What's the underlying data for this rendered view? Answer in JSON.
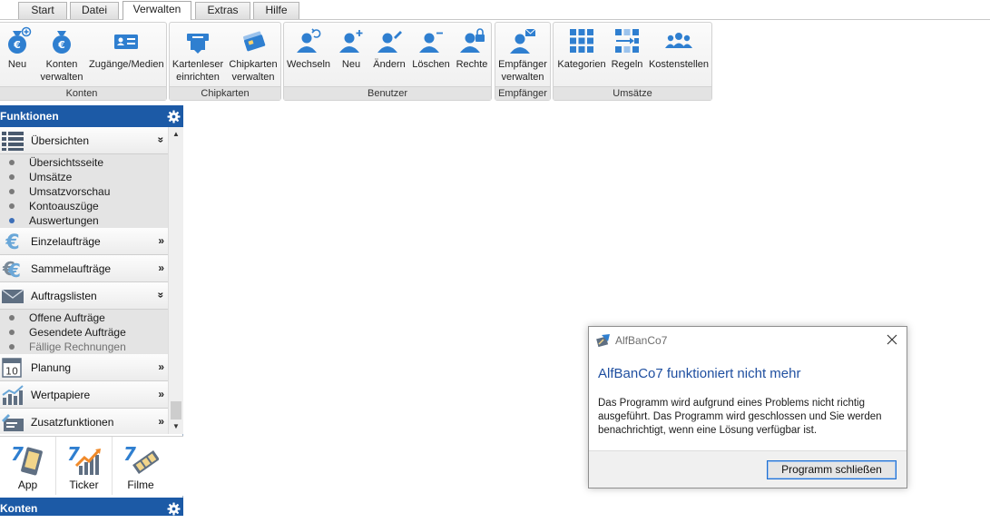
{
  "menu": {
    "tabs": [
      {
        "label": "Start"
      },
      {
        "label": "Datei"
      },
      {
        "label": "Verwalten",
        "active": true
      },
      {
        "label": "Extras"
      },
      {
        "label": "Hilfe"
      }
    ]
  },
  "ribbon": {
    "groups": [
      {
        "label": "Konten",
        "buttons": [
          {
            "line1": "Neu",
            "line2": "",
            "icon": "money-bag-plus-icon"
          },
          {
            "line1": "Konten",
            "line2": "verwalten",
            "icon": "money-bag-icon"
          },
          {
            "line1": "Zugänge/Medien",
            "line2": "",
            "icon": "id-card-icon"
          }
        ]
      },
      {
        "label": "Chipkarten",
        "buttons": [
          {
            "line1": "Kartenleser",
            "line2": "einrichten",
            "icon": "card-reader-icon"
          },
          {
            "line1": "Chipkarten",
            "line2": "verwalten",
            "icon": "chip-cards-icon"
          }
        ]
      },
      {
        "label": "Benutzer",
        "buttons": [
          {
            "line1": "Wechseln",
            "line2": "",
            "icon": "user-switch-icon"
          },
          {
            "line1": "Neu",
            "line2": "",
            "icon": "user-add-icon"
          },
          {
            "line1": "Ändern",
            "line2": "",
            "icon": "user-edit-icon"
          },
          {
            "line1": "Löschen",
            "line2": "",
            "icon": "user-remove-icon"
          },
          {
            "line1": "Rechte",
            "line2": "",
            "icon": "user-lock-icon"
          }
        ]
      },
      {
        "label": "Empfänger",
        "buttons": [
          {
            "line1": "Empfänger",
            "line2": "verwalten",
            "icon": "user-mail-icon"
          }
        ]
      },
      {
        "label": "Umsätze",
        "buttons": [
          {
            "line1": "Kategorien",
            "line2": "",
            "icon": "grid-icon"
          },
          {
            "line1": "Regeln",
            "line2": "",
            "icon": "rules-icon"
          },
          {
            "line1": "Kostenstellen",
            "line2": "",
            "icon": "group-icon"
          }
        ]
      }
    ]
  },
  "sidebar": {
    "header": "Funktionen",
    "sections": [
      {
        "label": "Übersichten",
        "chevron": "»",
        "expanded": true,
        "icon": "list-icon",
        "items": [
          {
            "label": "Übersichtsseite"
          },
          {
            "label": "Umsätze"
          },
          {
            "label": "Umsatzvorschau"
          },
          {
            "label": "Kontoauszüge"
          },
          {
            "label": "Auswertungen",
            "selected": true
          }
        ]
      },
      {
        "label": "Einzelaufträge",
        "chevron": "»",
        "icon": "euro-icon"
      },
      {
        "label": "Sammelaufträge",
        "chevron": "»",
        "icon": "euro-stack-icon"
      },
      {
        "label": "Auftragslisten",
        "chevron": "»",
        "expanded": true,
        "icon": "envelope-icon",
        "items": [
          {
            "label": "Offene Aufträge"
          },
          {
            "label": "Gesendete Aufträge"
          },
          {
            "label": "Fällige Rechnungen",
            "muted": true
          }
        ]
      },
      {
        "label": "Planung",
        "chevron": "»",
        "icon": "calendar-icon",
        "day": "10"
      },
      {
        "label": "Wertpapiere",
        "chevron": "»",
        "icon": "chart-icon"
      },
      {
        "label": "Zusatzfunktionen",
        "chevron": "»",
        "icon": "tools-icon"
      }
    ],
    "quicklinks": [
      {
        "label": "App",
        "icon": "app-phone-icon"
      },
      {
        "label": "Ticker",
        "icon": "ticker-icon"
      },
      {
        "label": "Filme",
        "icon": "film-icon"
      }
    ],
    "second_header": "Konten"
  },
  "dialog": {
    "title": "AlfBanCo7",
    "heading": "AlfBanCo7 funktioniert nicht mehr",
    "message": "Das Programm wird aufgrund eines Problems nicht richtig ausgeführt. Das Programm wird geschlossen und Sie werden benachrichtigt, wenn eine Lösung verfügbar ist.",
    "button_label": "Programm schließen"
  },
  "colors": {
    "accent_blue": "#1c5aa6",
    "icon_blue": "#2f7fd0",
    "dialog_heading": "#1f4fa0"
  }
}
